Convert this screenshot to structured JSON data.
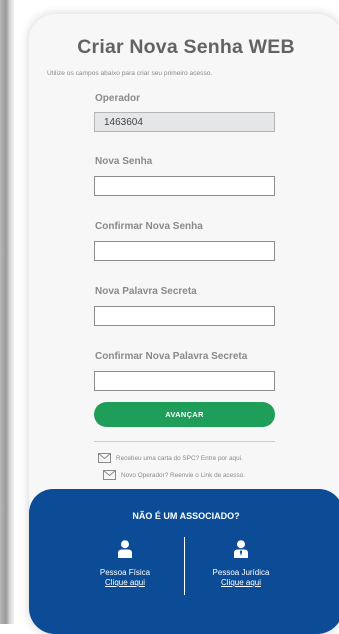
{
  "page": {
    "title": "Criar Nova Senha WEB",
    "subtitle": "Utilize os campos abaixo para criar seu primeiro acesso."
  },
  "form": {
    "operator_label": "Operador",
    "operator_value": "1463604",
    "new_password_label": "Nova Senha",
    "new_password_value": "",
    "confirm_password_label": "Confirmar Nova Senha",
    "confirm_password_value": "",
    "secret_word_label": "Nova Palavra Secreta",
    "secret_word_value": "",
    "confirm_secret_word_label": "Confirmar Nova Palavra Secreta",
    "confirm_secret_word_value": "",
    "submit_label": "AVANÇAR"
  },
  "help": {
    "letter_link": "Recebeu uma carta do SPC? Entre por aqui.",
    "resend_link": "Novo Operador? Reenvie o Link de acesso."
  },
  "footer": {
    "title": "NÃO É UM ASSOCIADO?",
    "individual_label": "Pessoa Física",
    "individual_link": "Clique aqui",
    "company_label": "Pessoa Jurídica",
    "company_link": "Clique aqui"
  },
  "icons": {
    "help_letter": "mail-icon",
    "help_resend": "mail-icon",
    "individual": "person-icon",
    "company": "business-person-icon"
  },
  "colors": {
    "brand_blue": "#0c4c97",
    "button_green": "#1e9e58",
    "text_gray": "#8a8a8a",
    "title_gray": "#636363"
  }
}
